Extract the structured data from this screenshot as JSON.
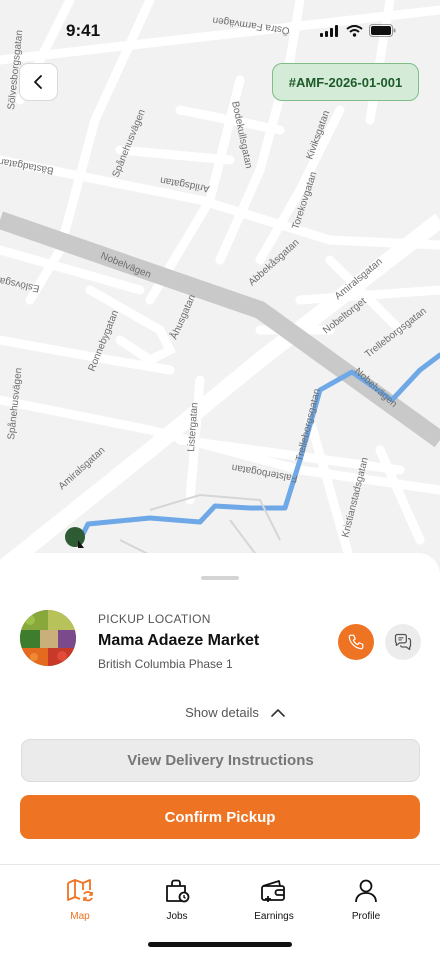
{
  "status_bar": {
    "time": "9:41"
  },
  "map": {
    "streets": [
      "Östra Farmvägen",
      "Bodekullsgatan",
      "Kiviksgatan",
      "Spånehusvägen",
      "Bästadgatan",
      "Arildsgatan",
      "Torekovgatan",
      "Nobelvägen",
      "Abbekåsgatan",
      "Amiralsgatan",
      "Eslövsgatan",
      "Ronnebygatan",
      "Åhusgatan",
      "Nobeltorget",
      "Trelleborgsgatan",
      "Listergatan",
      "Falsterbogatan",
      "Kristianstadsgatan",
      "Amiralsgatan",
      "Spånehusvägen",
      "Trelleborgsgatan",
      "Nobelvägen",
      "Sölvesborgsgatan"
    ]
  },
  "order": {
    "tag": "#AMF-2026-01-001"
  },
  "pickup": {
    "label": "PICKUP LOCATION",
    "name": "Mama Adaeze Market",
    "address": "British Columbia Phase 1"
  },
  "actions": {
    "show_details": "Show details",
    "view_instructions": "View Delivery Instructions",
    "confirm": "Confirm Pickup"
  },
  "tabs": [
    {
      "label": "Map",
      "icon": "map-icon"
    },
    {
      "label": "Jobs",
      "icon": "jobs-bag-icon"
    },
    {
      "label": "Earnings",
      "icon": "wallet-icon"
    },
    {
      "label": "Profile",
      "icon": "user-icon"
    }
  ],
  "colors": {
    "accent": "#ee7322",
    "route": "#6fa8e6",
    "tag_bg": "#d4ecd7",
    "tag_text": "#1f5a2a"
  }
}
